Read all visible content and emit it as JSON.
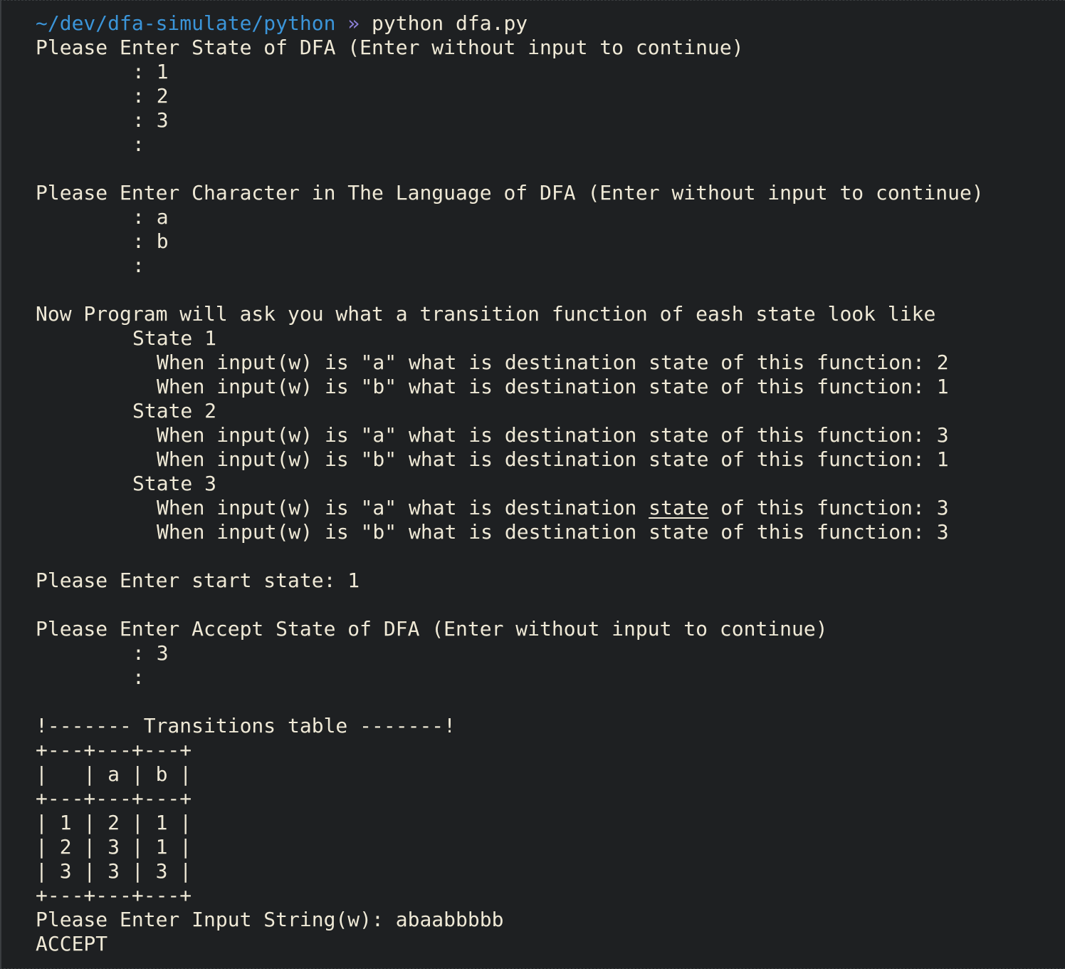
{
  "prompt": {
    "path": "~/dev/dfa-simulate/python",
    "arrow": "»",
    "command": "python dfa.py"
  },
  "states_section": {
    "header": "Please Enter State of DFA (Enter without input to continue)",
    "entries": [
      ": 1",
      ": 2",
      ": 3",
      ":"
    ]
  },
  "language_section": {
    "header": "Please Enter Character in The Language of DFA (Enter without input to continue)",
    "entries": [
      ": a",
      ": b",
      ":"
    ]
  },
  "transition_section": {
    "header": "Now Program will ask you what a transition function of eash state look like",
    "states": [
      {
        "label": "State 1",
        "lines": [
          "When input(w) is \"a\" what is destination state of this function: 2",
          "When input(w) is \"b\" what is destination state of this function: 1"
        ]
      },
      {
        "label": "State 2",
        "lines": [
          "When input(w) is \"a\" what is destination state of this function: 3",
          "When input(w) is \"b\" what is destination state of this function: 1"
        ]
      },
      {
        "label": "State 3",
        "line_a_pre": "When input(w) is \"a\" what is destination ",
        "line_a_word": "state",
        "line_a_post": " of this function: 3",
        "line_b": "When input(w) is \"b\" what is destination state of this function: 3"
      }
    ]
  },
  "start_state": "Please Enter start state: 1",
  "accept_section": {
    "header": "Please Enter Accept State of DFA (Enter without input to continue)",
    "entries": [
      ": 3",
      ":"
    ]
  },
  "table": {
    "title": "!------- Transitions table -------!",
    "border": "+---+---+---+",
    "header_row": "|   | a | b |",
    "rows": [
      "| 1 | 2 | 1 |",
      "| 2 | 3 | 1 |",
      "| 3 | 3 | 3 |"
    ]
  },
  "input_string": "Please Enter Input String(w): abaabbbbb",
  "result": "ACCEPT"
}
